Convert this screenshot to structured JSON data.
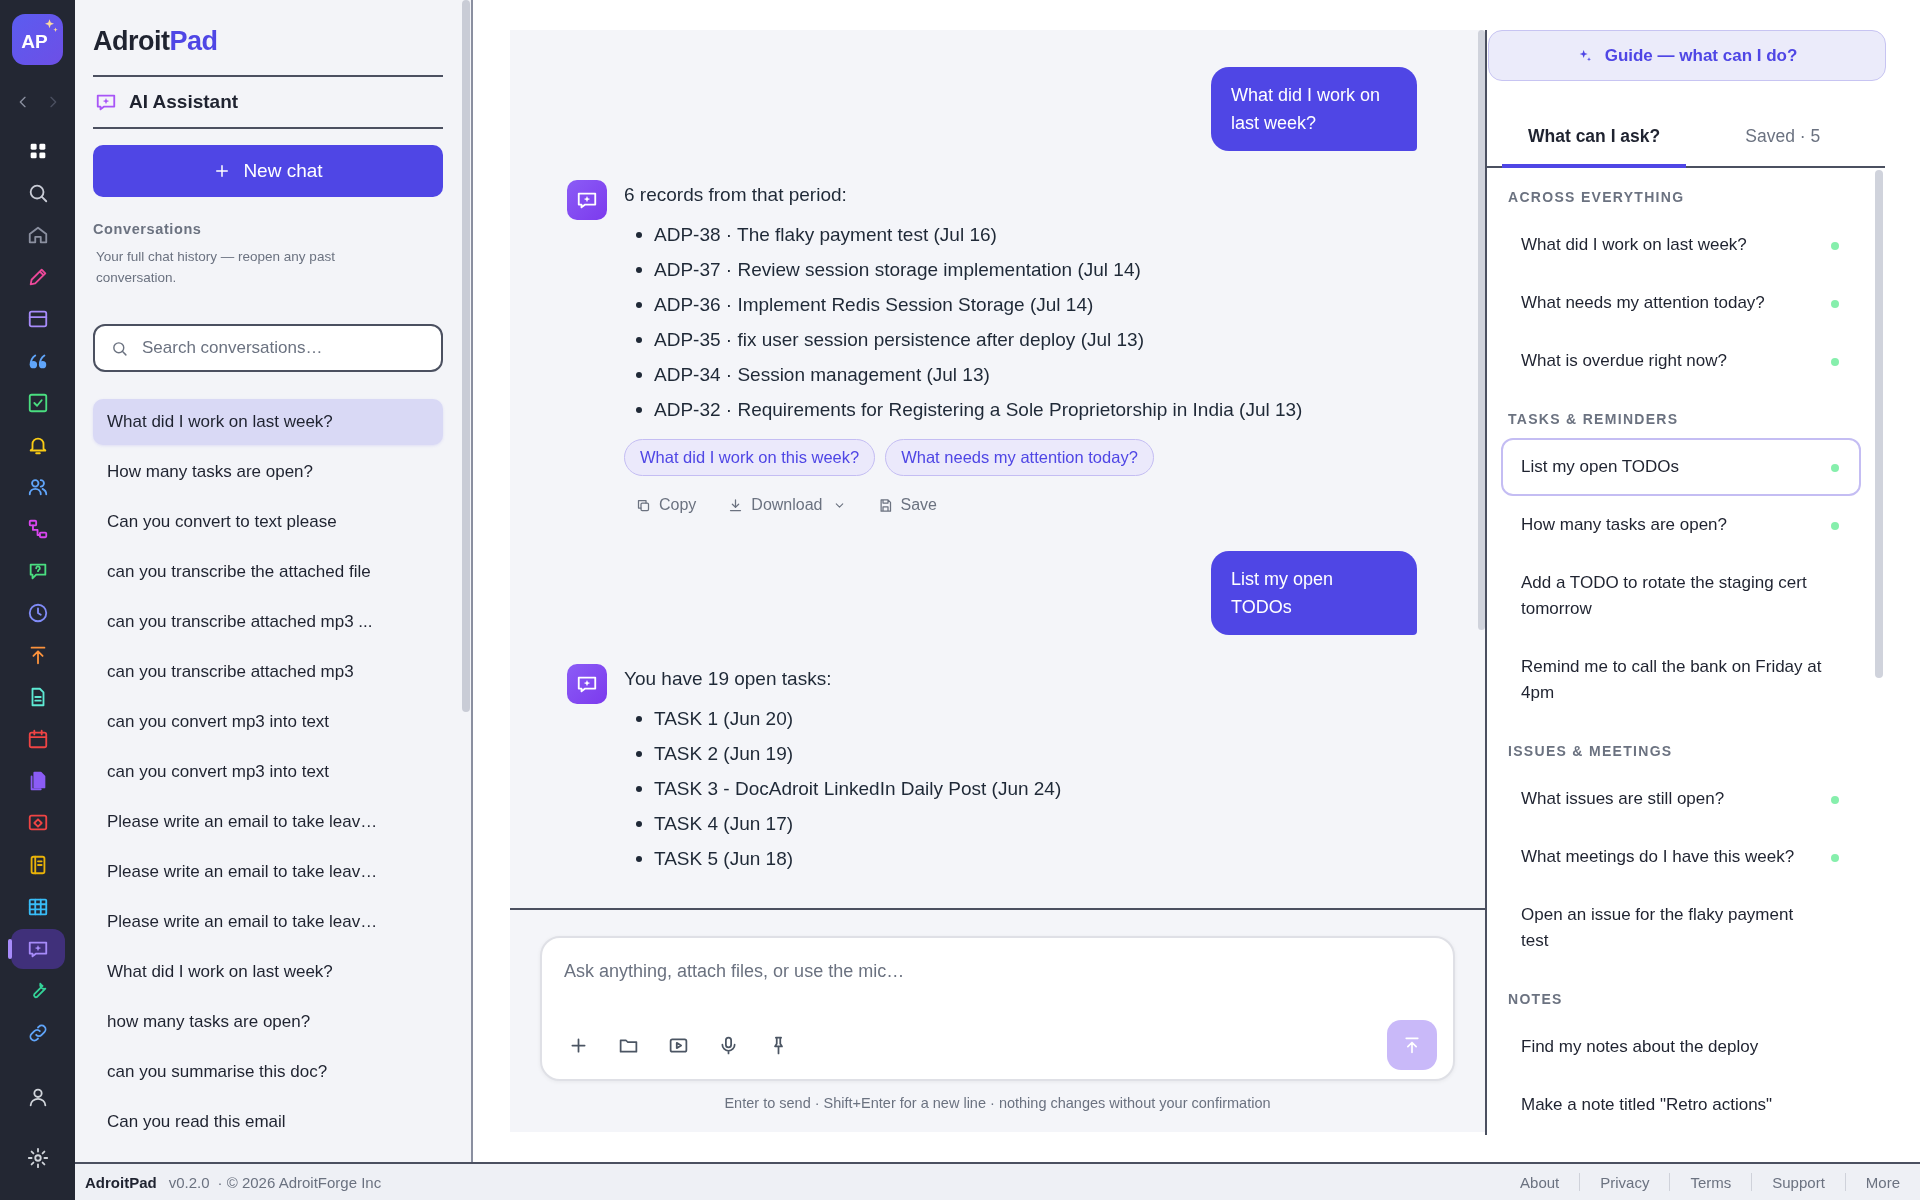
{
  "rail": {
    "logo": "AP",
    "items": [
      {
        "kind": "grid",
        "selected": false
      },
      {
        "kind": "search",
        "selected": false
      },
      {
        "kind": "home",
        "selected": false
      },
      {
        "kind": "pencil",
        "selected": false
      },
      {
        "kind": "store",
        "selected": false
      },
      {
        "kind": "quote",
        "selected": false
      },
      {
        "kind": "checkbox",
        "selected": false
      },
      {
        "kind": "bell",
        "selected": false
      },
      {
        "kind": "users",
        "selected": false
      },
      {
        "kind": "flow",
        "selected": false
      },
      {
        "kind": "chat-help",
        "selected": false
      },
      {
        "kind": "clock",
        "selected": false
      },
      {
        "kind": "upload",
        "selected": false
      },
      {
        "kind": "document",
        "selected": false
      },
      {
        "kind": "calendar",
        "selected": false
      },
      {
        "kind": "files",
        "selected": false
      },
      {
        "kind": "screen",
        "selected": false
      },
      {
        "kind": "notebook",
        "selected": false
      },
      {
        "kind": "table",
        "selected": false
      },
      {
        "kind": "chat-spark",
        "selected": true
      },
      {
        "kind": "wrench",
        "selected": false
      },
      {
        "kind": "link",
        "selected": false
      }
    ]
  },
  "sidebar": {
    "brand": [
      "Adroit",
      "Pad"
    ],
    "section_title": "AI Assistant",
    "new_chat": "New chat",
    "conversations_heading": "Conversations",
    "conversations_note": "Your full chat history — reopen any past conversation.",
    "search": {
      "placeholder": "Search conversations…"
    },
    "conversations": [
      {
        "title": "What did I work on last week?",
        "selected": true
      },
      {
        "title": "How many tasks are open?",
        "selected": false
      },
      {
        "title": "Can you convert to text please",
        "selected": false
      },
      {
        "title": "can you transcribe the attached file",
        "selected": false
      },
      {
        "title": "can you transcribe attached mp3 ...",
        "selected": false
      },
      {
        "title": "can you transcribe attached mp3",
        "selected": false
      },
      {
        "title": "can you convert mp3 into text",
        "selected": false
      },
      {
        "title": "can you convert mp3 into text",
        "selected": false
      },
      {
        "title": "Please write an email to take leav…",
        "selected": false
      },
      {
        "title": "Please write an email to take leav…",
        "selected": false
      },
      {
        "title": "Please write an email to take leav…",
        "selected": false
      },
      {
        "title": "What did I work on last week?",
        "selected": false
      },
      {
        "title": "how many tasks are open?",
        "selected": false
      },
      {
        "title": "can you summarise this doc?",
        "selected": false
      },
      {
        "title": "Can you read this email",
        "selected": false
      }
    ]
  },
  "chat": {
    "messages": [
      {
        "kind": "user",
        "text": "What did I work on last week?"
      },
      {
        "kind": "assistant",
        "intro": "6 records from that period:",
        "items": [
          "ADP-38 · The flaky payment test (Jul 16)",
          "ADP-37 · Review session storage implementation (Jul 14)",
          "ADP-36 · Implement Redis Session Storage (Jul 14)",
          "ADP-35 · fix user session persistence after deploy (Jul 13)",
          "ADP-34 · Session management (Jul 13)",
          "ADP-32 · Requirements for Registering a Sole Proprietorship in India (Jul 13)"
        ],
        "suggestions": [
          "What did I work on this week?",
          "What needs my attention today?"
        ],
        "actions": [
          {
            "kind": "copy",
            "label": "Copy"
          },
          {
            "kind": "download",
            "label": "Download"
          },
          {
            "kind": "save",
            "label": "Save"
          }
        ]
      },
      {
        "kind": "user",
        "text": "List my open TODOs"
      },
      {
        "kind": "assistant",
        "intro": "You have 19 open tasks:",
        "items": [
          "TASK 1 (Jun 20)",
          "TASK 2 (Jun 19)",
          "TASK 3 - DocAdroit LinkedIn Daily Post (Jun 24)",
          "TASK 4 (Jun 17)",
          "TASK 5 (Jun 18)"
        ]
      }
    ],
    "composer": {
      "placeholder": "Ask anything, attach files, or use the mic…",
      "tools": [
        {
          "kind": "plus"
        },
        {
          "kind": "folder"
        },
        {
          "kind": "video"
        },
        {
          "kind": "mic"
        },
        {
          "kind": "pin"
        }
      ],
      "hint": "Enter to send · Shift+Enter for a new line · nothing changes without your confirmation"
    }
  },
  "guide": {
    "button": "Guide — what can I do?",
    "tabs": [
      {
        "label": "What can I ask?",
        "selected": true
      },
      {
        "label": "Saved · 5",
        "selected": false
      }
    ],
    "sections": [
      {
        "heading": "ACROSS EVERYTHING",
        "items": [
          {
            "text": "What did I work on last week?",
            "indicator": true,
            "selected": false
          },
          {
            "text": "What needs my attention today?",
            "indicator": true,
            "selected": false
          },
          {
            "text": "What is overdue right now?",
            "indicator": true,
            "selected": false
          }
        ]
      },
      {
        "heading": "TASKS & REMINDERS",
        "items": [
          {
            "text": "List my open TODOs",
            "indicator": true,
            "selected": true
          },
          {
            "text": "How many tasks are open?",
            "indicator": true,
            "selected": false
          },
          {
            "text": "Add a TODO to rotate the staging cert tomorrow",
            "indicator": false,
            "selected": false
          },
          {
            "text": "Remind me to call the bank on Friday at 4pm",
            "indicator": false,
            "selected": false
          }
        ]
      },
      {
        "heading": "ISSUES & MEETINGS",
        "items": [
          {
            "text": "What issues are still open?",
            "indicator": true,
            "selected": false
          },
          {
            "text": "What meetings do I have this week?",
            "indicator": true,
            "selected": false
          },
          {
            "text": "Open an issue for the flaky payment test",
            "indicator": false,
            "selected": false
          }
        ]
      },
      {
        "heading": "NOTES",
        "items": [
          {
            "text": "Find my notes about the deploy",
            "indicator": false,
            "selected": false
          },
          {
            "text": "Make a note titled \"Retro actions\"",
            "indicator": false,
            "selected": false
          }
        ]
      }
    ]
  },
  "footer": {
    "app": "AdroitPad",
    "version": "v0.2.0",
    "copyright": "· © 2026 AdroitForge Inc",
    "links": [
      "About",
      "Privacy",
      "Terms",
      "Support",
      "More"
    ]
  }
}
